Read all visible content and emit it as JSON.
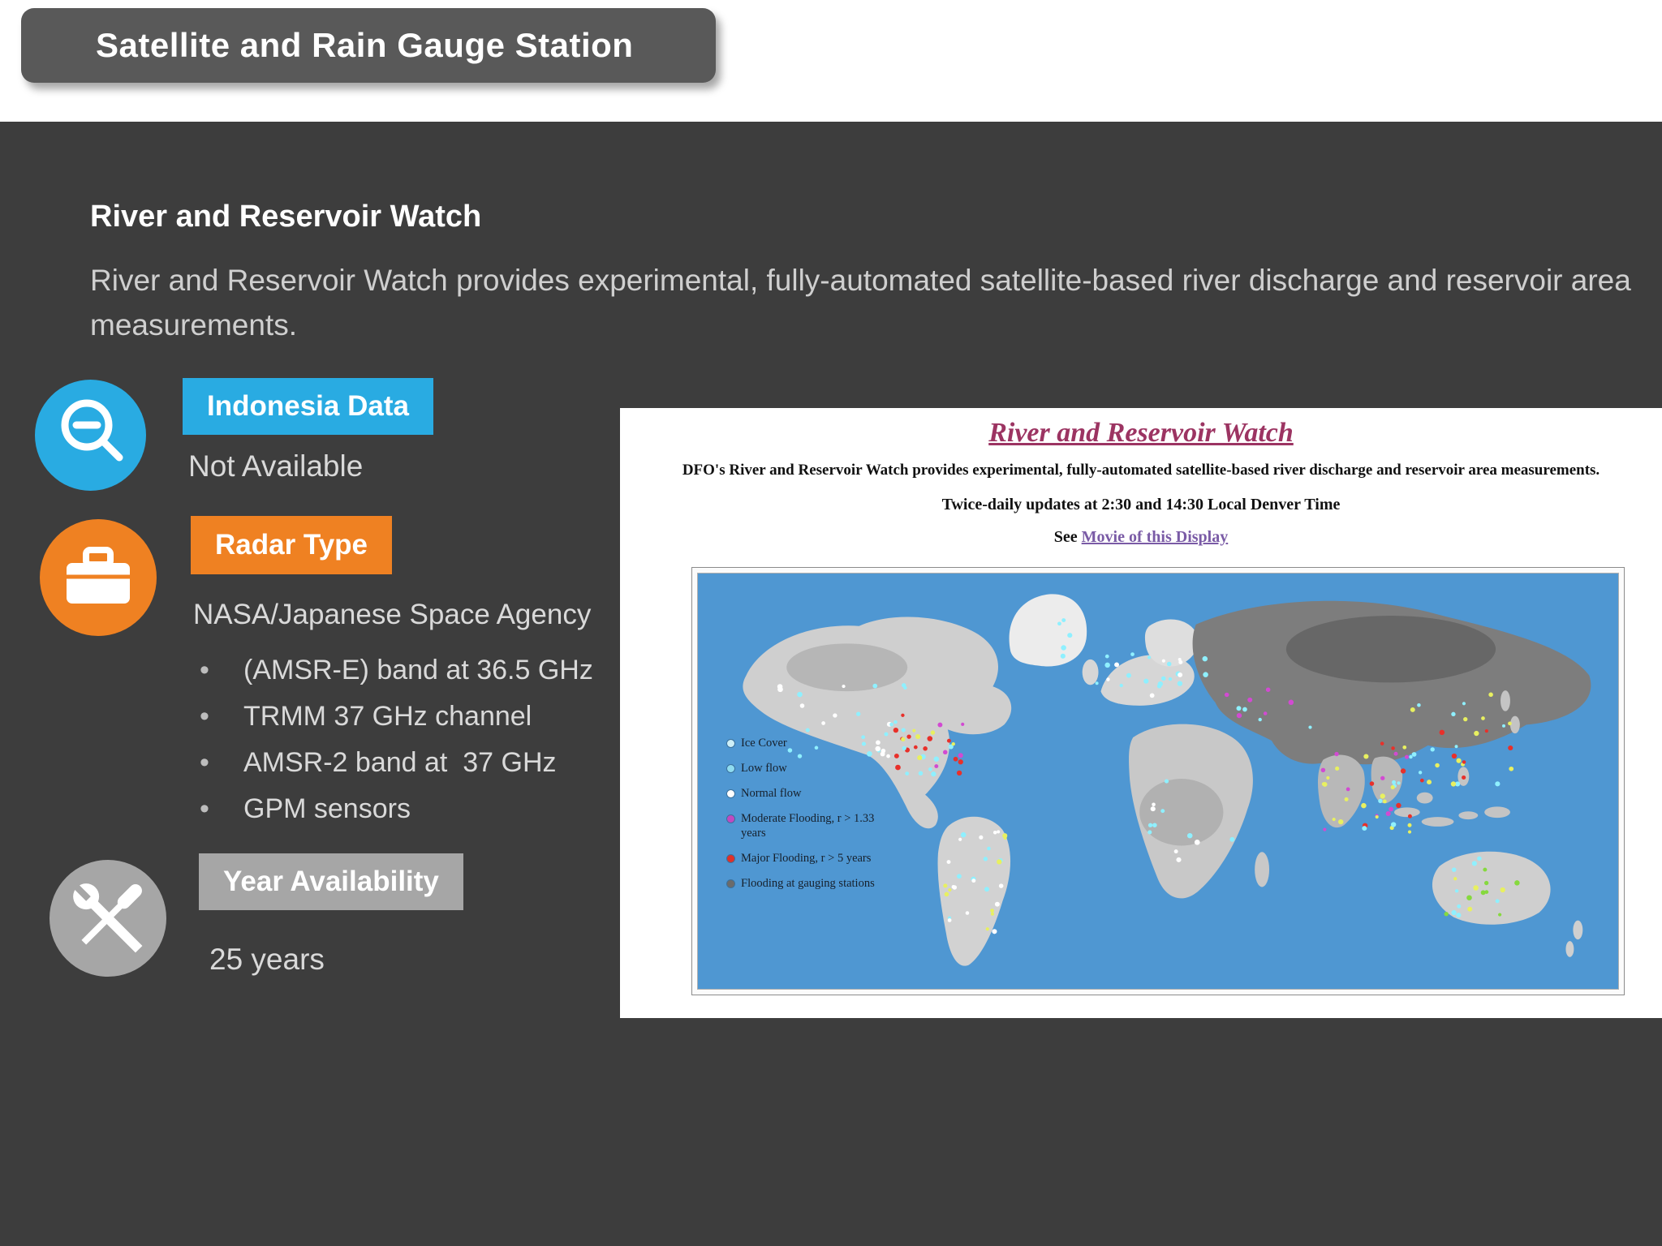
{
  "slide": {
    "tab_title": "Satellite and Rain Gauge Station",
    "heading": "River and Reservoir Watch",
    "description": "River and Reservoir Watch provides experimental, fully-automated satellite-based river discharge and reservoir area measurements.",
    "background_color": "#3d3d3d"
  },
  "info": {
    "indonesia": {
      "label": "Indonesia Data",
      "value": "Not Available",
      "accent": "#29abe2"
    },
    "radar": {
      "label": "Radar Type",
      "agency": "NASA/Japanese Space Agency",
      "bullets": [
        "(AMSR-E) band at 36.5 GHz",
        "TRMM 37 GHz channel",
        "AMSR-2 band at  37 GHz",
        "GPM sensors"
      ],
      "accent": "#ef8122"
    },
    "availability": {
      "label": "Year Availability",
      "value": "25 years",
      "accent": "#a6a6a6"
    }
  },
  "webpage": {
    "title": "River and Reservoir Watch",
    "intro": "DFO's River and Reservoir Watch provides experimental, fully-automated satellite-based river discharge and reservoir area measurements.",
    "updates": "Twice-daily updates at 2:30 and 14:30 Local Denver Time",
    "see_prefix": "See ",
    "movie_link": "Movie of this Display",
    "ocean_color": "#4f97d2",
    "map_legend": [
      {
        "label": "Ice Cover",
        "color": "#cdeff8"
      },
      {
        "label": "Low flow",
        "color": "#8fdcf0"
      },
      {
        "label": "Normal flow",
        "color": "#ffffff"
      },
      {
        "label": "Moderate Flooding, r > 1.33 years",
        "color": "#c04ac0"
      },
      {
        "label": "Major Flooding, r > 5 years",
        "color": "#e03028"
      },
      {
        "label": "Flooding at gauging stations",
        "color": "#6b6b6b"
      }
    ]
  }
}
